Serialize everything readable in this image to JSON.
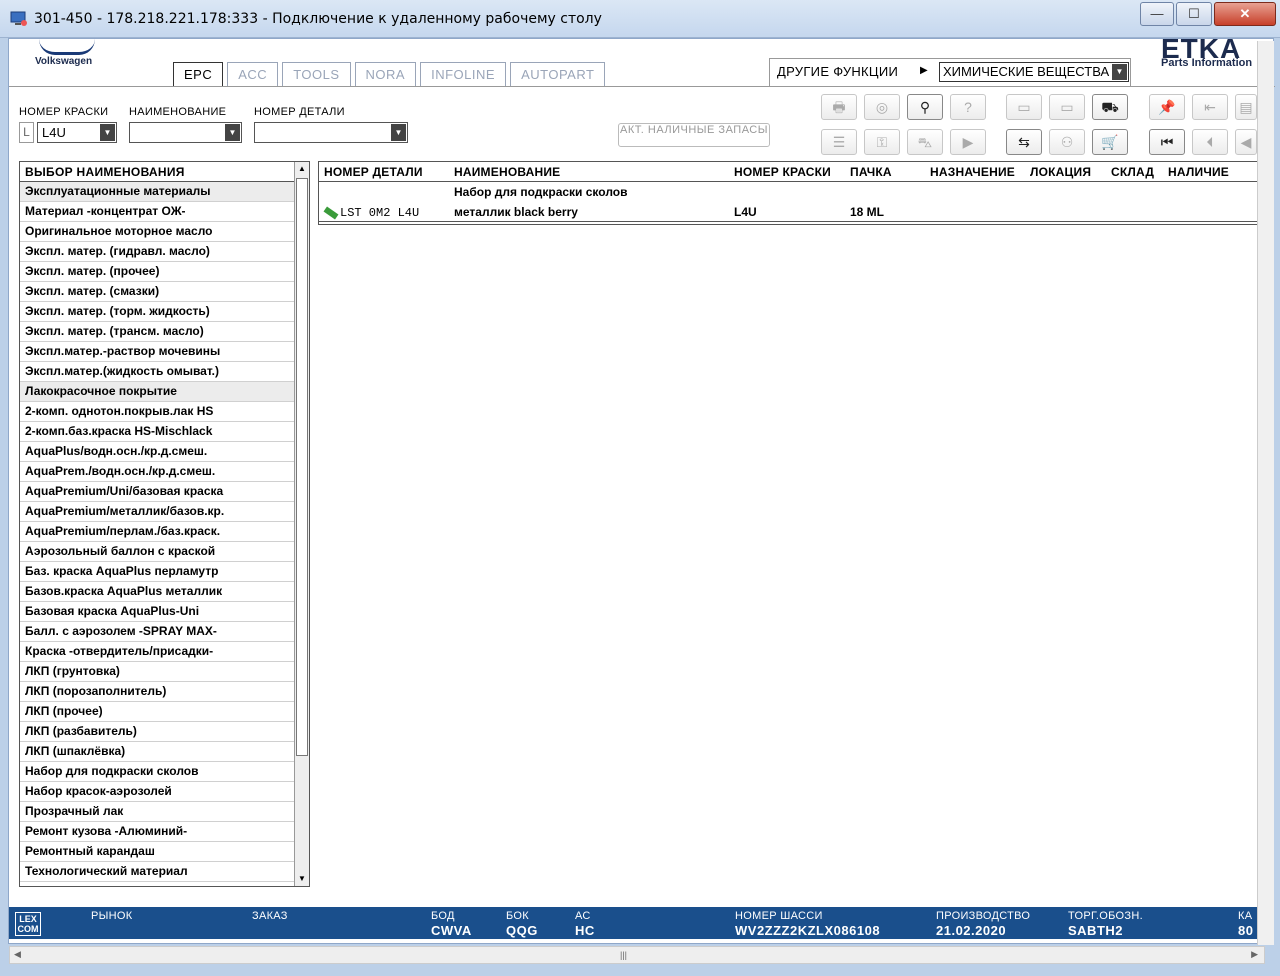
{
  "window": {
    "title": "301-450 - 178.218.221.178:333 - Подключение к удаленному рабочему столу",
    "min": "—",
    "max": "☐",
    "close": "✕"
  },
  "brand": {
    "vw_text": "Volkswagen",
    "etka_text": "ETKA",
    "etka_sub": "Parts Information"
  },
  "tabs": [
    "EPC",
    "ACC",
    "TOOLS",
    "NORA",
    "INFOLINE",
    "AUTOPART"
  ],
  "other_functions": {
    "label": "ДРУГИЕ ФУНКЦИИ",
    "value": "ХИМИЧЕСКИЕ ВЕЩЕСТВА"
  },
  "filters": {
    "paint_label": "НОМЕР КРАСКИ",
    "paint_prefix": "L",
    "paint_value": "L4U",
    "name_label": "НАИМЕНОВАНИЕ",
    "name_value": "",
    "part_label": "НОМЕР ДЕТАЛИ",
    "part_value": ""
  },
  "avail_button": "АКТ. НАЛИЧНЫЕ ЗАПАСЫ",
  "left_list": {
    "header": "ВЫБОР НАИМЕНОВАНИЯ",
    "items": [
      {
        "label": "Эксплуатационные материалы",
        "group": true
      },
      {
        "label": "Материал -концентрат ОЖ-",
        "group": false
      },
      {
        "label": "Оригинальное моторное масло",
        "group": false
      },
      {
        "label": "Экспл. матер. (гидравл. масло)",
        "group": false
      },
      {
        "label": "Экспл. матер. (прочее)",
        "group": false
      },
      {
        "label": "Экспл. матер. (смазки)",
        "group": false
      },
      {
        "label": "Экспл. матер. (торм. жидкость)",
        "group": false
      },
      {
        "label": "Экспл. матер. (трансм. масло)",
        "group": false
      },
      {
        "label": "Экспл.матер.-раствор мочевины",
        "group": false
      },
      {
        "label": "Экспл.матер.(жидкость омыват.)",
        "group": false
      },
      {
        "label": "Лакокрасочное покрытие",
        "group": true
      },
      {
        "label": "2-комп. однотон.покрыв.лак HS",
        "group": false
      },
      {
        "label": "2-комп.баз.краска HS-Mischlack",
        "group": false
      },
      {
        "label": "AquaPlus/водн.осн./кр.д.смеш.",
        "group": false
      },
      {
        "label": "AquaPrem./водн.осн./кр.д.смеш.",
        "group": false
      },
      {
        "label": "AquaPremium/Uni/базовая краска",
        "group": false
      },
      {
        "label": "AquaPremium/металлик/базов.кр.",
        "group": false
      },
      {
        "label": "AquaPremium/перлам./баз.краск.",
        "group": false
      },
      {
        "label": "Аэрозольный баллон с краской",
        "group": false
      },
      {
        "label": "Баз. краска AquaPlus перламутр",
        "group": false
      },
      {
        "label": "Базов.краска AquaPlus металлик",
        "group": false
      },
      {
        "label": "Базовая краска AquaPlus-Uni",
        "group": false
      },
      {
        "label": "Балл. с аэрозолем  -SPRAY MAX-",
        "group": false
      },
      {
        "label": "Краска -отвердитель/присадки-",
        "group": false
      },
      {
        "label": "ЛКП (грунтовка)",
        "group": false
      },
      {
        "label": "ЛКП (порозаполнитель)",
        "group": false
      },
      {
        "label": "ЛКП (прочее)",
        "group": false
      },
      {
        "label": "ЛКП (разбавитель)",
        "group": false
      },
      {
        "label": "ЛКП (шпаклёвка)",
        "group": false
      },
      {
        "label": "Набор для подкраски сколов",
        "group": false
      },
      {
        "label": "Набор красок-аэрозолей",
        "group": false
      },
      {
        "label": "Прозрачный лак",
        "group": false
      },
      {
        "label": "Ремонт кузова -Алюминий-",
        "group": false
      },
      {
        "label": "Ремонтный карандаш",
        "group": false
      },
      {
        "label": "Технологический материал",
        "group": false
      }
    ]
  },
  "parts_table": {
    "headers": [
      "НОМЕР ДЕТАЛИ",
      "НАИМЕНОВАНИЕ",
      "НОМЕР КРАСКИ",
      "ПАЧКА",
      "НАЗНАЧЕНИЕ",
      "ЛОКАЦИЯ",
      "СКЛАД",
      "НАЛИЧИЕ"
    ],
    "group_row": "Набор для подкраски сколов",
    "row": {
      "part": "LST 0M2 L4U",
      "name": "металлик black berry",
      "paint": "L4U",
      "pack": "18 ML"
    }
  },
  "status": {
    "logo": "LEX COM",
    "market_label": "РЫНОК",
    "order_label": "ЗАКАЗ",
    "bod_label": "БОД",
    "bod_value": "CWVA",
    "bok_label": "БОК",
    "bok_value": "QQG",
    "ac_label": "АС",
    "ac_value": "HC",
    "chassis_label": "НОМЕР ШАССИ",
    "chassis_value": "WV2ZZZ2KZLX086108",
    "prod_label": "ПРОИЗВОДСТВО",
    "prod_value": "21.02.2020",
    "trade_label": "ТОРГ.ОБОЗН.",
    "trade_value": "SABTH2",
    "extra_label": "КА",
    "extra_value": "80"
  },
  "colors": {
    "statusbar": "#1a4f8c",
    "titlebar": "#c5d7ee",
    "close_button": "#c7402a"
  }
}
